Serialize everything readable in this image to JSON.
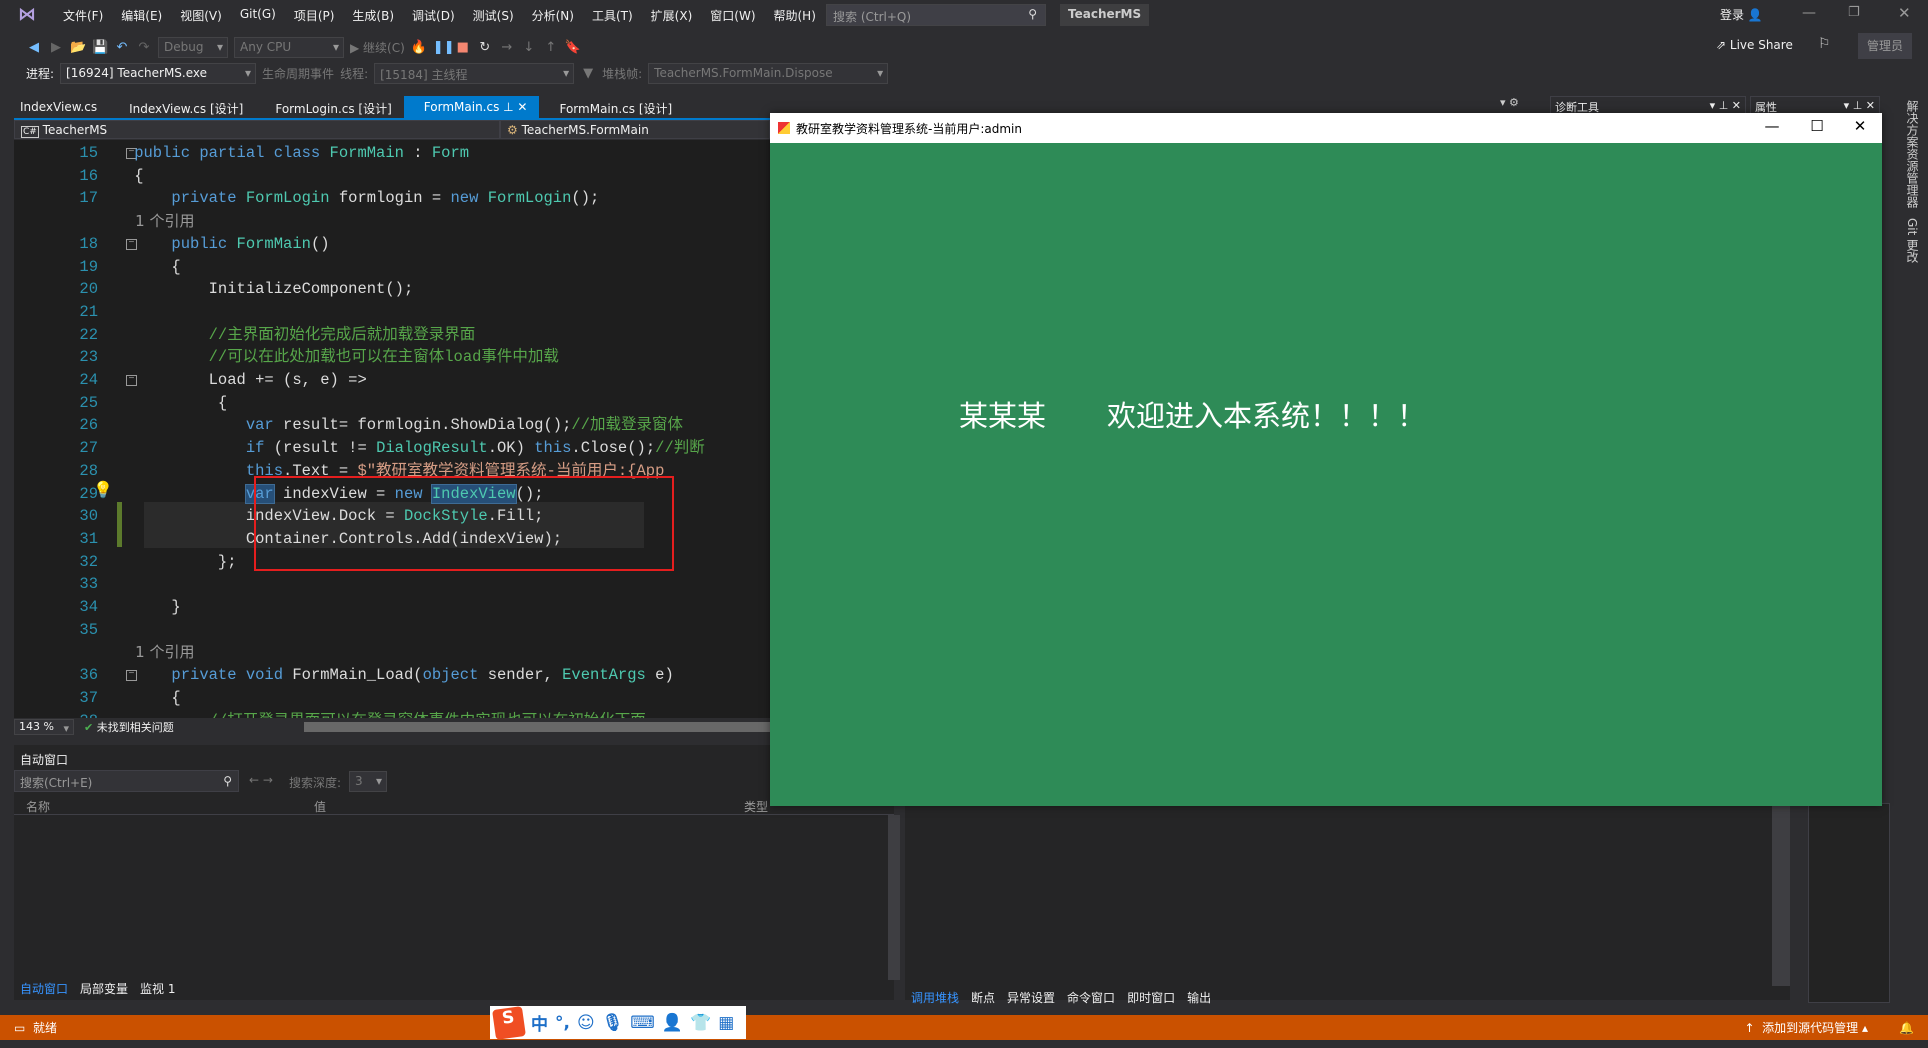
{
  "app": {
    "solution_name": "TeacherMS",
    "login": "登录",
    "live_share": "Live Share",
    "admin": "管理员",
    "menu": [
      "文件(F)",
      "编辑(E)",
      "视图(V)",
      "Git(G)",
      "项目(P)",
      "生成(B)",
      "调试(D)",
      "测试(S)",
      "分析(N)",
      "工具(T)",
      "扩展(X)",
      "窗口(W)",
      "帮助(H)"
    ],
    "search_placeholder": "搜索 (Ctrl+Q)"
  },
  "toolbar": {
    "config": "Debug",
    "platform": "Any CPU",
    "continue": "继续(C)",
    "process_label": "进程:",
    "process": "[16924] TeacherMS.exe",
    "lifecycle": "生命周期事件",
    "thread_label": "线程:",
    "thread": "[15184] 主线程",
    "stack_label": "堆栈帧:",
    "stack": "TeacherMS.FormMain.Dispose"
  },
  "tabs": [
    {
      "label": "IndexView.cs"
    },
    {
      "label": "IndexView.cs [设计]"
    },
    {
      "label": "FormLogin.cs [设计]"
    },
    {
      "label": "FormMain.cs",
      "active": true
    },
    {
      "label": "FormMain.cs [设计]"
    }
  ],
  "navbar": {
    "project": "TeacherMS",
    "class": "TeacherMS.FormMain"
  },
  "code": [
    {
      "n": "15",
      "fold": true,
      "t": [
        [
          "    public partial class ",
          "kw"
        ],
        [
          "FormMain",
          "ty"
        ],
        [
          " : ",
          ""
        ],
        [
          "Form",
          "ty"
        ]
      ]
    },
    {
      "n": "16",
      "t": [
        [
          "    {",
          ""
        ]
      ]
    },
    {
      "n": "17",
      "t": [
        [
          "        private ",
          "kw"
        ],
        [
          "FormLogin",
          "ty"
        ],
        [
          " formlogin = ",
          ""
        ],
        [
          "new ",
          "kw"
        ],
        [
          "FormLogin",
          "ty"
        ],
        [
          "();",
          ""
        ]
      ]
    },
    {
      "n": "",
      "t": [
        [
          "        1 个引用",
          "lens"
        ]
      ]
    },
    {
      "n": "18",
      "fold": true,
      "t": [
        [
          "        public ",
          "kw"
        ],
        [
          "FormMain",
          "ty"
        ],
        [
          "()",
          ""
        ]
      ]
    },
    {
      "n": "19",
      "t": [
        [
          "        {",
          ""
        ]
      ]
    },
    {
      "n": "20",
      "t": [
        [
          "            InitializeComponent();",
          ""
        ]
      ]
    },
    {
      "n": "21",
      "t": []
    },
    {
      "n": "22",
      "t": [
        [
          "            //主界面初始化完成后就加载登录界面",
          "cm"
        ]
      ]
    },
    {
      "n": "23",
      "t": [
        [
          "            //可以在此处加载也可以在主窗体load事件中加载",
          "cm"
        ]
      ]
    },
    {
      "n": "24",
      "fold": true,
      "t": [
        [
          "            Load += (s, e) =>",
          ""
        ]
      ]
    },
    {
      "n": "25",
      "t": [
        [
          "             {",
          ""
        ]
      ]
    },
    {
      "n": "26",
      "t": [
        [
          "                var ",
          "kw"
        ],
        [
          "result= formlogin.ShowDialog();",
          ""
        ],
        [
          "//加载登录窗体",
          "cm"
        ]
      ]
    },
    {
      "n": "27",
      "t": [
        [
          "                if ",
          "kw"
        ],
        [
          "(result != ",
          ""
        ],
        [
          "DialogResult",
          "ty"
        ],
        [
          ".OK) ",
          ""
        ],
        [
          "this",
          "kw"
        ],
        [
          ".Close();",
          ""
        ],
        [
          "//判断",
          "cm"
        ]
      ]
    },
    {
      "n": "28",
      "t": [
        [
          "                this",
          "kw"
        ],
        [
          ".Text = ",
          ""
        ],
        [
          "$\"教研室教学资料管理系统-当前用户:{App",
          "st"
        ]
      ]
    },
    {
      "n": "29",
      "t": [
        [
          "                ",
          ""
        ],
        [
          "var",
          "kw sel"
        ],
        [
          " indexView = ",
          ""
        ],
        [
          "new ",
          "kw"
        ],
        [
          "IndexView",
          "ty sel"
        ],
        [
          "();",
          ""
        ]
      ]
    },
    {
      "n": "30",
      "t": [
        [
          "                indexView.Dock = ",
          ""
        ],
        [
          "DockStyle",
          "ty"
        ],
        [
          ".Fill;",
          ""
        ]
      ]
    },
    {
      "n": "31",
      "t": [
        [
          "                Container.Controls.Add(indexView);",
          ""
        ]
      ]
    },
    {
      "n": "32",
      "t": [
        [
          "             };",
          ""
        ]
      ]
    },
    {
      "n": "33",
      "t": []
    },
    {
      "n": "34",
      "t": [
        [
          "        }",
          ""
        ]
      ]
    },
    {
      "n": "35",
      "t": []
    },
    {
      "n": "",
      "t": [
        [
          "        1 个引用",
          "lens"
        ]
      ]
    },
    {
      "n": "36",
      "fold": true,
      "t": [
        [
          "        private void ",
          "kw"
        ],
        [
          "FormMain_Load(",
          ""
        ],
        [
          "object ",
          "kw"
        ],
        [
          "sender, ",
          ""
        ],
        [
          "EventArgs",
          "ty"
        ],
        [
          " e)",
          ""
        ]
      ]
    },
    {
      "n": "37",
      "t": [
        [
          "        {",
          ""
        ]
      ]
    },
    {
      "n": "38",
      "t": [
        [
          "            //打开登录界面可以在登录窗体事件中实现也可以在初始化下面",
          "cm"
        ]
      ]
    }
  ],
  "editor_status": {
    "zoom": "143 %",
    "issues": "未找到相关问题"
  },
  "auto_window": {
    "title": "自动窗口",
    "search_placeholder": "搜索(Ctrl+E)",
    "depth_label": "搜索深度:",
    "depth": "3",
    "columns": [
      "名称",
      "值",
      "类型"
    ]
  },
  "bottom_tabs_left": [
    "自动窗口",
    "局部变量",
    "监视 1"
  ],
  "bottom_tabs_right": [
    "调用堆栈",
    "断点",
    "异常设置",
    "命令窗口",
    "即时窗口",
    "输出"
  ],
  "right_panels": {
    "diag": "诊断工具",
    "props": "属性",
    "side1": "解决方案资源管理器",
    "side2": "Git 更改"
  },
  "statusbar": {
    "ready": "就绪",
    "source_control": "添加到源代码管理"
  },
  "form": {
    "title": "教研室教学资料管理系统-当前用户:admin",
    "name": "某某某",
    "welcome": "欢迎进入本系统！！！！",
    "bg": "#2E8B57"
  }
}
